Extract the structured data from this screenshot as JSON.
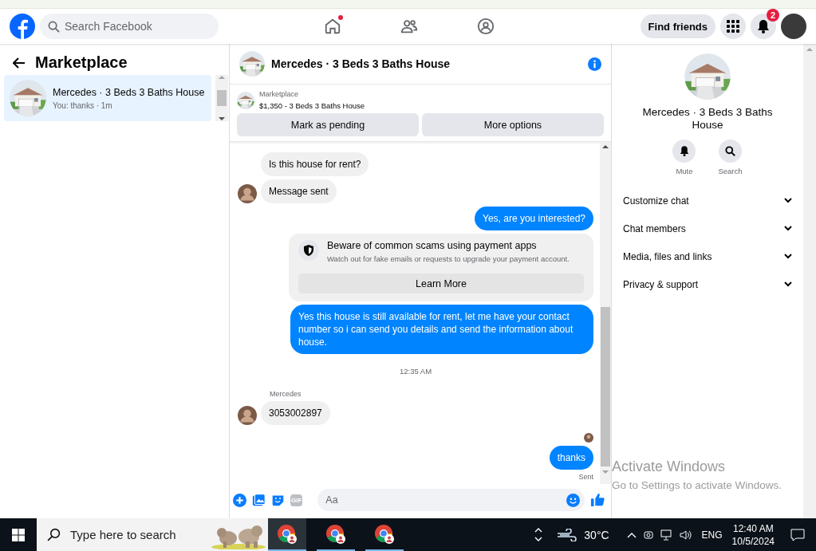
{
  "header": {
    "search": {
      "placeholder": "Search Facebook"
    },
    "nav": [
      {
        "kind": "home",
        "badge": true
      },
      {
        "kind": "friends",
        "badge": false
      },
      {
        "kind": "groups",
        "badge": false
      }
    ],
    "find_friends": "Find friends",
    "notifications": {
      "count": "2"
    }
  },
  "left": {
    "title": "Marketplace",
    "chats": [
      {
        "name": "Mercedes · 3 Beds 3 Baths House",
        "preview": "You: thanks · 1m",
        "selected": true
      }
    ]
  },
  "chat": {
    "title": "Mercedes · 3 Beds 3 Baths House",
    "listing": {
      "source": "Marketplace",
      "summary": "$1,350 - 3 Beds 3 Baths House"
    },
    "actions": [
      "Mark as pending",
      "More options"
    ],
    "messages": [
      {
        "kind": "incoming",
        "text": "Is this house for rent?",
        "avatar": false
      },
      {
        "kind": "incoming",
        "text": "Message sent",
        "avatar": true
      },
      {
        "kind": "outgoing",
        "text": "Yes, are you interested?"
      },
      {
        "kind": "notice",
        "title": "Beware of common scams using payment apps",
        "text": "Watch out for fake emails or requests to upgrade your payment account.",
        "button": "Learn More"
      },
      {
        "kind": "outgoing",
        "text": "Yes this house is still available for rent, let me have your contact number so i can send you details and send the information about house."
      },
      {
        "kind": "time",
        "text": "12:35 AM"
      },
      {
        "kind": "incoming",
        "sender": "Mercedes",
        "text": "3053002897",
        "avatar": true
      },
      {
        "kind": "seen"
      },
      {
        "kind": "outgoing",
        "text": "thanks",
        "status": "Sent"
      }
    ],
    "composer": {
      "gif": "GIF",
      "placeholder": "Aa"
    }
  },
  "info": {
    "title": "Mercedes · 3 Beds 3 Baths House",
    "actions": [
      {
        "kind": "mute",
        "label": "Mute"
      },
      {
        "kind": "search",
        "label": "Search"
      }
    ],
    "sections": [
      {
        "label": "Customize chat",
        "expanded": false
      },
      {
        "label": "Chat members",
        "expanded": false
      },
      {
        "label": "Media, files and links",
        "expanded": false
      },
      {
        "label": "Privacy & support",
        "expanded": false
      }
    ]
  },
  "os_notice": {
    "title": "Activate Windows",
    "text": "Go to Settings to activate Windows."
  },
  "taskbar": {
    "search": {
      "placeholder": "Type here to search"
    },
    "apps": [
      {
        "selected": true
      },
      {
        "selected": false
      },
      {
        "selected": false
      }
    ],
    "weather": "30°C",
    "language": "ENG",
    "time": "12:40 AM",
    "date": "10/5/2024"
  }
}
